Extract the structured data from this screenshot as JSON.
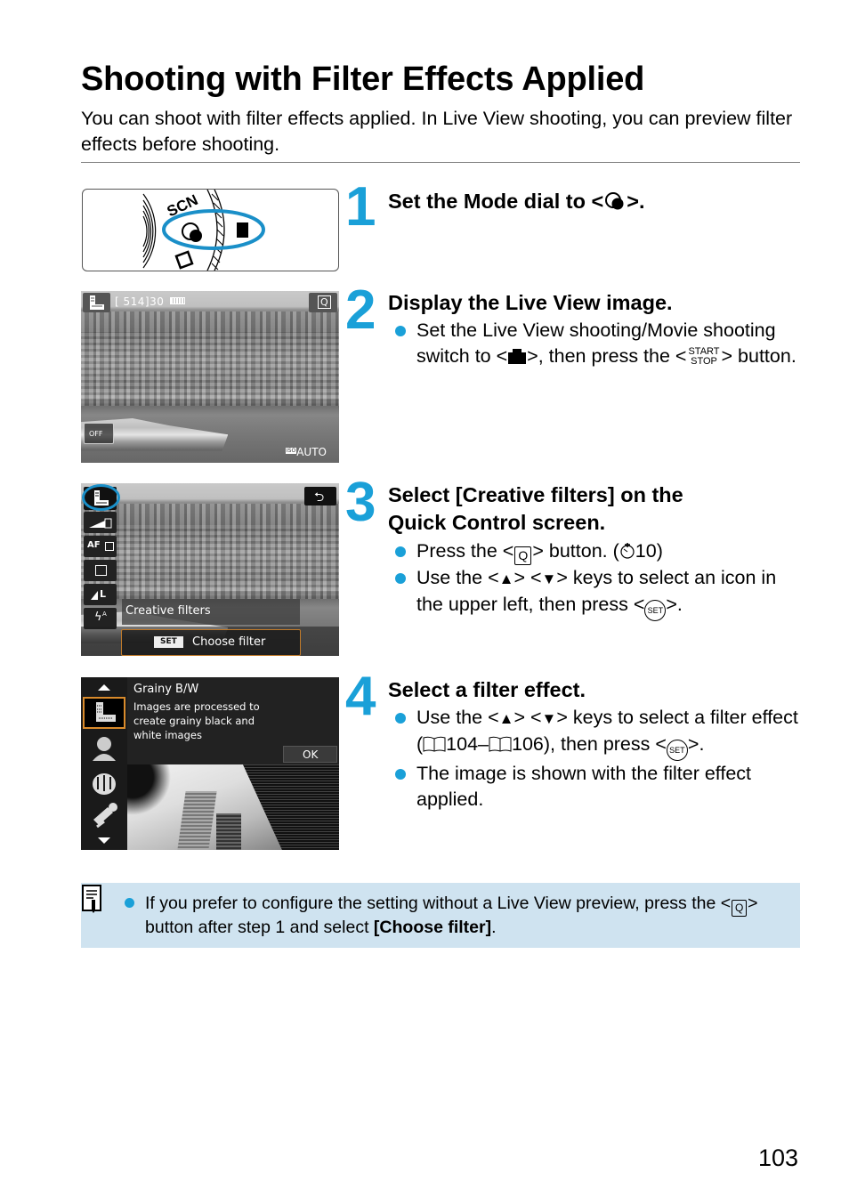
{
  "page": {
    "title": "Shooting with Filter Effects Applied",
    "intro": "You can shoot with filter effects applied. In Live View shooting, you can preview filter effects before shooting.",
    "page_number": "103"
  },
  "colors": {
    "accent": "#1aa0d8",
    "note_background": "#cfe3f0",
    "highlight_ring": "#1a8fc8",
    "selection_orange": "#d98a2b"
  },
  "steps": [
    {
      "number": "1",
      "heading_pre": "Set the Mode dial to <",
      "heading_icon": "creative-filter-mode-icon",
      "heading_post": ">.",
      "image": {
        "type": "mode-dial",
        "labels": [
          "SCN"
        ]
      }
    },
    {
      "number": "2",
      "heading": "Display the Live View image.",
      "bullets": [
        {
          "pre": "Set the Live View shooting/Movie shooting switch to <",
          "icon": "camera-icon",
          "mid": ">, then press the <",
          "icon2_top": "START",
          "icon2_bottom": "STOP",
          "post": "> button."
        }
      ],
      "image": {
        "type": "live-view",
        "shots_remaining": "[ 514]",
        "shots_suffix": "30",
        "iso_label": "ISO",
        "iso_value": "AUTO",
        "q_label": "Q",
        "off_label": "OFF"
      }
    },
    {
      "number": "3",
      "heading_line1": "Select [Creative filters] on the",
      "heading_line2": "Quick Control screen.",
      "bullets": [
        {
          "pre": "Press the <",
          "icon": "Q",
          "mid": "> button. (",
          "timer": "10",
          "post": ")"
        },
        {
          "pre": "Use the <",
          "up": "▲",
          "mid1": "> <",
          "down": "▼",
          "mid2": "> keys to select an icon in the upper left, then press <",
          "set": "SET",
          "post": ">."
        }
      ],
      "image": {
        "type": "quick-control",
        "menu_label": "Creative filters",
        "set_label": "SET",
        "choose_label": "Choose filter",
        "af_label": "AF",
        "size_label": "L",
        "flash_label": "A"
      }
    },
    {
      "number": "4",
      "heading": "Select a filter effect.",
      "bullets": [
        {
          "pre": "Use the <",
          "up": "▲",
          "mid1": "> <",
          "down": "▼",
          "mid2": "> keys to select a filter effect (",
          "page1": "104",
          "dash": "–",
          "page2": "106",
          "mid3": "), then press <",
          "set": "SET",
          "post": ">."
        },
        {
          "text": "The image is shown with the filter effect applied."
        }
      ],
      "image": {
        "type": "filter-select",
        "filter_name": "Grainy B/W",
        "filter_desc_1": "Images are processed to",
        "filter_desc_2": "create grainy black and",
        "filter_desc_3": "white images",
        "ok_label": "OK"
      }
    }
  ],
  "note": {
    "pre": "If you prefer to configure the setting without a Live View preview, press the <",
    "icon": "Q",
    "mid": "> button after step 1 and select ",
    "bold": "[Choose filter]",
    "post": "."
  }
}
